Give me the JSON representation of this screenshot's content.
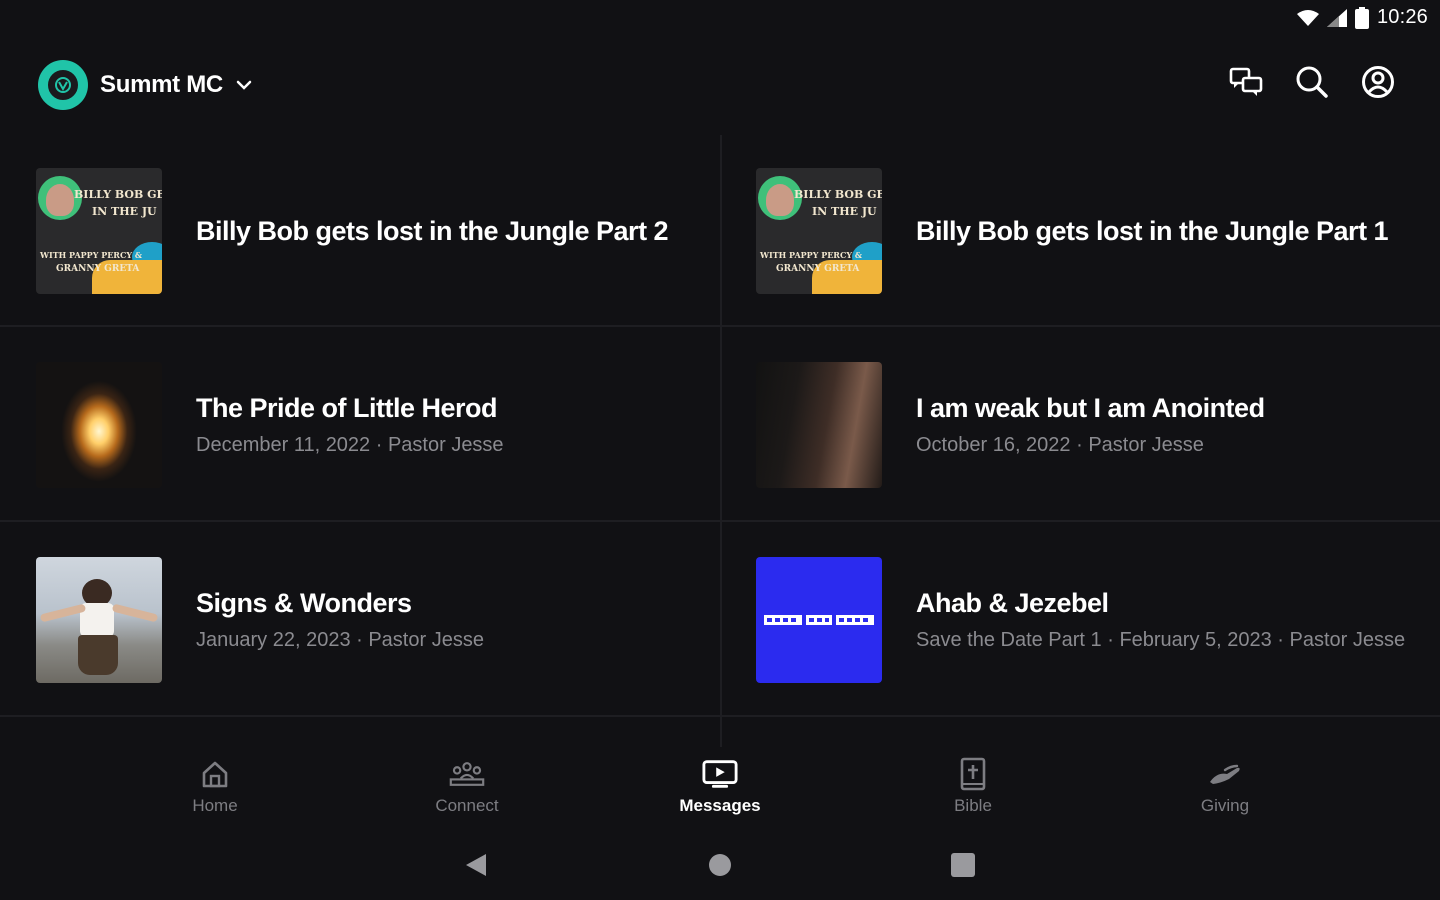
{
  "status": {
    "time": "10:26"
  },
  "header": {
    "org_name": "Summt MC",
    "icons": [
      "chat-icon",
      "search-icon",
      "account-icon"
    ]
  },
  "messages": [
    {
      "title": "Billy Bob gets lost in the Jungle Part 2",
      "subtitle": ""
    },
    {
      "title": "Billy Bob gets lost in the Jungle Part 1",
      "subtitle": ""
    },
    {
      "title": "The Pride of Little Herod",
      "subtitle": "December 11, 2022 · Pastor Jesse"
    },
    {
      "title": "I am weak but I am Anointed",
      "subtitle": "October 16, 2022 · Pastor Jesse"
    },
    {
      "title": "Signs & Wonders",
      "subtitle": "January 22, 2023 · Pastor Jesse"
    },
    {
      "title": "Ahab & Jezebel",
      "subtitle": "Save the Date Part 1 · February 5, 2023 · Pastor Jesse"
    }
  ],
  "thumb_text": {
    "billy_line1": "BILLY BOB GE",
    "billy_line2": "IN THE JU",
    "billy_line3": "WITH PAPPY PERCY &",
    "billy_line4": "GRANNY GRETA"
  },
  "nav": {
    "items": [
      {
        "label": "Home",
        "icon": "home-icon"
      },
      {
        "label": "Connect",
        "icon": "people-icon"
      },
      {
        "label": "Messages",
        "icon": "tv-play-icon"
      },
      {
        "label": "Bible",
        "icon": "bible-icon"
      },
      {
        "label": "Giving",
        "icon": "giving-hand-icon"
      }
    ],
    "active": "Messages"
  },
  "colors": {
    "background": "#111114",
    "accent_teal": "#20c4a8",
    "ahab_blue": "#2b2bef",
    "muted_text": "#8b8b90"
  }
}
